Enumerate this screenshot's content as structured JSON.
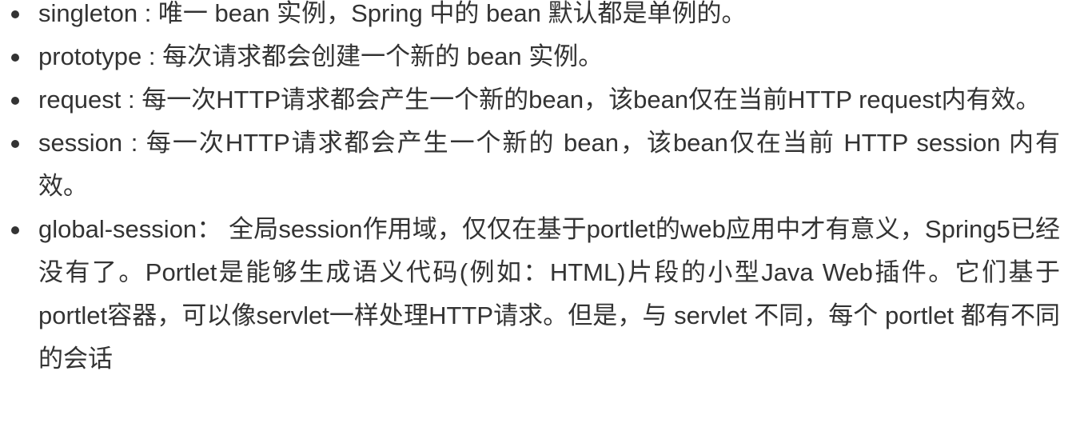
{
  "scopes": [
    {
      "term": "singleton",
      "text": "singleton : 唯一 bean 实例，Spring 中的 bean 默认都是单例的。"
    },
    {
      "term": "prototype",
      "text": "prototype : 每次请求都会创建一个新的 bean 实例。"
    },
    {
      "term": "request",
      "text": "request : 每一次HTTP请求都会产生一个新的bean，该bean仅在当前HTTP request内有效。"
    },
    {
      "term": "session",
      "text": "session : 每一次HTTP请求都会产生一个新的 bean，该bean仅在当前 HTTP session 内有效。"
    },
    {
      "term": "global-session",
      "text": "global-session： 全局session作用域，仅仅在基于portlet的web应用中才有意义，Spring5已经没有了。Portlet是能够生成语义代码(例如：HTML)片段的小型Java Web插件。它们基于portlet容器，可以像servlet一样处理HTTP请求。但是，与 servlet 不同，每个 portlet 都有不同的会话"
    }
  ]
}
